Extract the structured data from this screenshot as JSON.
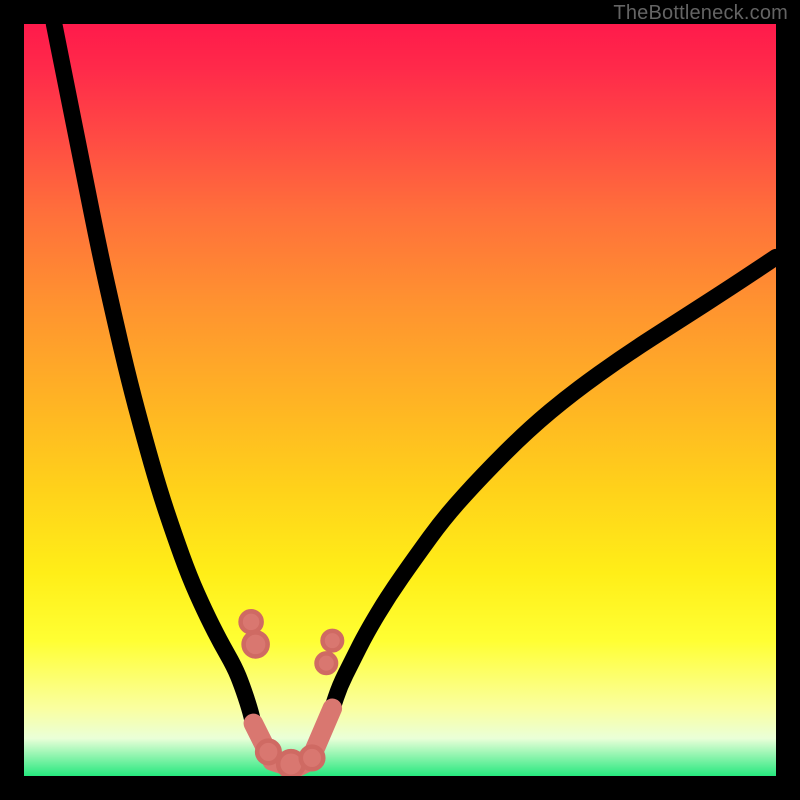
{
  "attribution": "TheBottleneck.com",
  "colors": {
    "frame": "#000000",
    "attribution_text": "#646464",
    "curve": "#000000",
    "bead": "#d97770",
    "gradient_top": "#ff1a4b",
    "gradient_bottom": "#26e87e"
  },
  "chart_data": {
    "type": "line",
    "title": "",
    "xlabel": "",
    "ylabel": "",
    "xlim": [
      0,
      100
    ],
    "ylim": [
      0,
      100
    ],
    "y_axis_inverted": true,
    "grid": false,
    "legend": false,
    "note": "x/y are in percent of the inner plot area; y=0 is top (red) and y=100 is bottom (green). Lower values at bottom indicate optimum.",
    "series": [
      {
        "name": "left-curve",
        "x": [
          4,
          6,
          8,
          10,
          12,
          14,
          16,
          18,
          20,
          22,
          24,
          26,
          28,
          29,
          30,
          30.5
        ],
        "y": [
          0,
          10,
          20,
          30,
          39,
          47.5,
          55,
          62,
          68,
          73.5,
          78,
          82,
          85.5,
          88,
          91,
          93
        ]
      },
      {
        "name": "right-curve",
        "x": [
          41,
          42,
          43.5,
          45.5,
          48.5,
          52,
          56,
          61,
          67,
          73,
          80,
          87,
          94,
          100
        ],
        "y": [
          91,
          88,
          85,
          81,
          76,
          71,
          65.5,
          60,
          54,
          49,
          44,
          39.5,
          35,
          31
        ]
      },
      {
        "name": "valley-floor",
        "x": [
          30.5,
          33,
          36,
          38,
          41
        ],
        "y": [
          93,
          98,
          99,
          98,
          91
        ]
      }
    ],
    "annotations": [
      {
        "name": "bead-left-upper",
        "x": 30.2,
        "y": 79.5,
        "r": 1.4
      },
      {
        "name": "bead-left-lower",
        "x": 30.8,
        "y": 82.5,
        "r": 1.6
      },
      {
        "name": "bead-right-upper",
        "x": 41.0,
        "y": 82.0,
        "r": 1.3
      },
      {
        "name": "bead-right-lower",
        "x": 40.2,
        "y": 85.0,
        "r": 1.3
      },
      {
        "name": "bead-bottom-left",
        "x": 32.5,
        "y": 96.8,
        "r": 1.5
      },
      {
        "name": "bead-bottom-mid",
        "x": 35.5,
        "y": 98.4,
        "r": 1.7
      },
      {
        "name": "bead-bottom-right",
        "x": 38.3,
        "y": 97.6,
        "r": 1.5
      }
    ],
    "valley_stroke": {
      "width_pct": 2.6
    }
  }
}
